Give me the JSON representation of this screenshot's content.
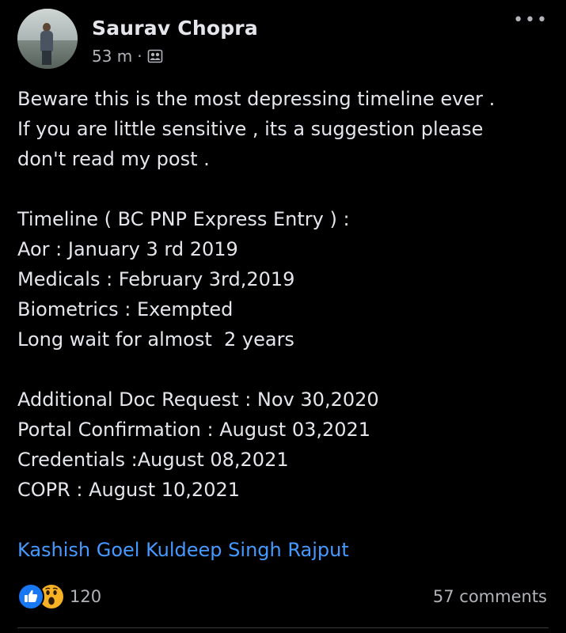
{
  "post": {
    "author": "Saurav Chopra",
    "time_ago": "53 m",
    "separator": "·",
    "audience_icon": "group-audience-icon",
    "more_icon": "•••",
    "body_lines": {
      "p1_l1": "Beware this is the most depressing timeline ever .",
      "p1_l2": "If you are little sensitive , its a suggestion please",
      "p1_l3": "don't read my post .",
      "p2_l1": "Timeline ( BC PNP Express Entry ) :",
      "p2_l2": "Aor : January 3 rd 2019",
      "p2_l3": "Medicals : February 3rd,2019",
      "p2_l4": "Biometrics : Exempted",
      "p2_l5": "Long wait for almost  2 years",
      "p3_l1": "Additional Doc Request : Nov 30,2020",
      "p3_l2": "Portal Confirmation : August 03,2021",
      "p3_l3": "Credentials :August 08,2021",
      "p3_l4": "COPR : August 10,2021"
    },
    "tags": {
      "tag1": "Kashish Goel",
      "tag2": "Kuldeep Singh Rajput"
    },
    "reactions": {
      "types": [
        "like",
        "wow"
      ],
      "count": "120"
    },
    "comments_label": "57 comments"
  },
  "colors": {
    "background": "#000000",
    "text_primary": "#e4e6eb",
    "text_secondary": "#b0b3b8",
    "link": "#4599ff",
    "like_blue": "#1877f2",
    "wow_yellow": "#f7b125"
  }
}
